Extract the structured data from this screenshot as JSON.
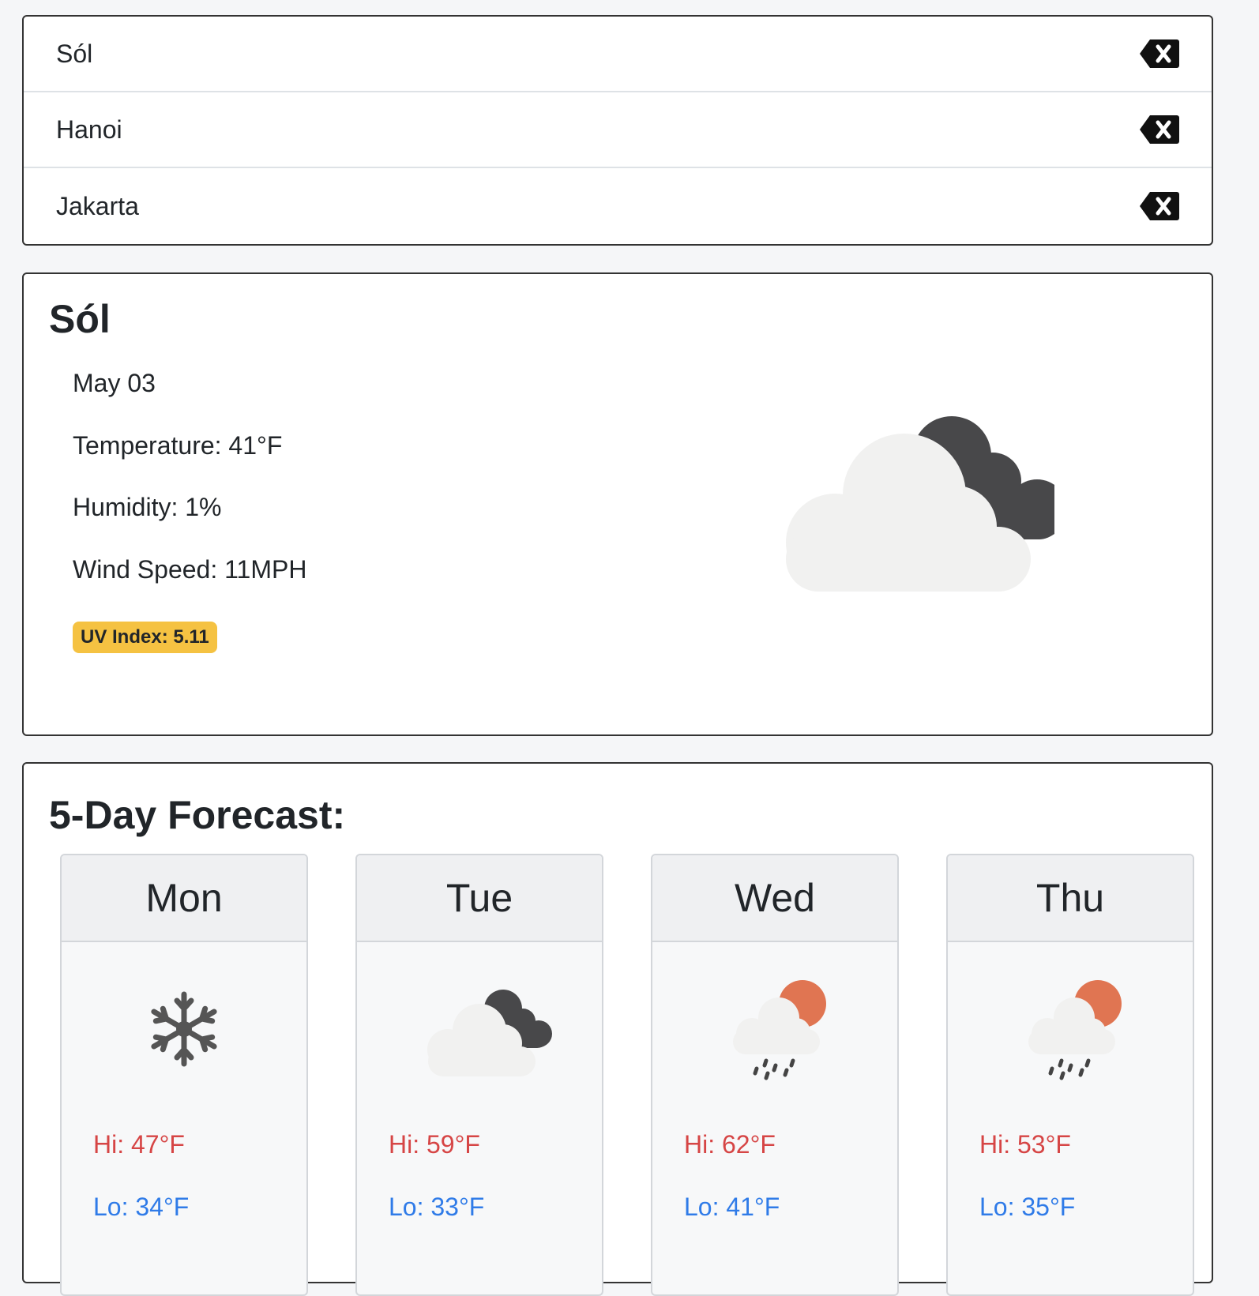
{
  "history": {
    "items": [
      {
        "name": "Sól",
        "delete_icon": "backspace-x-icon"
      },
      {
        "name": "Hanoi",
        "delete_icon": "backspace-x-icon"
      },
      {
        "name": "Jakarta",
        "delete_icon": "backspace-x-icon"
      }
    ]
  },
  "current": {
    "city": "Sól",
    "date": "May 03",
    "temperature": "Temperature: 41°F",
    "humidity": "Humidity: 1%",
    "wind": "Wind Speed: 11MPH",
    "uv": "UV Index: 5.11",
    "icon": "cloudy-dark-cloud-icon"
  },
  "forecast": {
    "title": "5-Day Forecast:",
    "days": [
      {
        "day": "Mon",
        "hi": "Hi: 47°F",
        "lo": "Lo: 34°F",
        "icon": "snowflake-icon"
      },
      {
        "day": "Tue",
        "hi": "Hi: 59°F",
        "lo": "Lo: 33°F",
        "icon": "cloudy-dark-cloud-icon"
      },
      {
        "day": "Wed",
        "hi": "Hi: 62°F",
        "lo": "Lo: 41°F",
        "icon": "rain-sun-icon"
      },
      {
        "day": "Thu",
        "hi": "Hi: 53°F",
        "lo": "Lo: 35°F",
        "icon": "rain-sun-icon"
      }
    ]
  },
  "colors": {
    "hi": "#d64545",
    "lo": "#2f7be8",
    "uv_badge": "#f5c242",
    "sun": "#e07552",
    "dark_cloud": "#48484a",
    "light_cloud": "#f1f1f0"
  }
}
